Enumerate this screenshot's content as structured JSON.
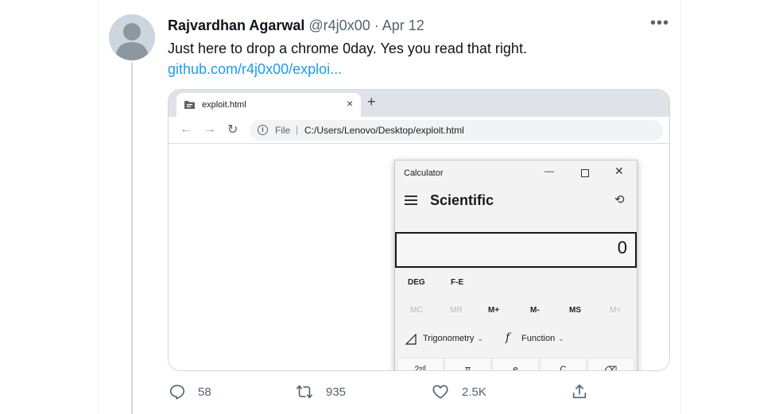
{
  "tweet": {
    "author_name": "Rajvardhan Agarwal",
    "handle": "@r4j0x00",
    "separator": "·",
    "date": "Apr 12",
    "text": "Just here to drop a chrome 0day. Yes you read that right.",
    "link": "github.com/r4j0x00/exploi...",
    "icons": [
      "avatar-placeholder",
      "more-icon"
    ]
  },
  "browser": {
    "tab_title": "exploit.html",
    "tab_close": "×",
    "new_tab": "+",
    "nav": {
      "back": "←",
      "forward": "→",
      "reload": "↻"
    },
    "info_glyph": "i",
    "scheme": "File",
    "separator": "|",
    "url": "C:/Users/Lenovo/Desktop/exploit.html"
  },
  "calculator": {
    "window_title": "Calculator",
    "window_controls": {
      "minimize": "—",
      "close": "✕"
    },
    "mode": "Scientific",
    "history_glyph": "⟲",
    "display_value": "0",
    "angle_mode": "DEG",
    "fe_label": "F-E",
    "memory": [
      {
        "label": "MC",
        "enabled": false
      },
      {
        "label": "MR",
        "enabled": false
      },
      {
        "label": "M+",
        "enabled": true
      },
      {
        "label": "M-",
        "enabled": true
      },
      {
        "label": "MS",
        "enabled": true
      },
      {
        "label": "M˅",
        "enabled": false
      }
    ],
    "tools": {
      "trigonometry": "Trigonometry",
      "function_glyph": "f",
      "function": "Function",
      "chevron": "⌄"
    },
    "keys": [
      "2ⁿᵈ",
      "π",
      "e",
      "C",
      "⌫"
    ]
  },
  "actions": {
    "reply_count": "58",
    "retweet_count": "935",
    "like_count": "2.5K",
    "icons": [
      "reply-icon",
      "retweet-icon",
      "like-icon",
      "share-icon"
    ],
    "icon_color": "#536471"
  },
  "colors": {
    "link": "#1d9bf0",
    "text": "#0f1419",
    "muted": "#536471"
  }
}
